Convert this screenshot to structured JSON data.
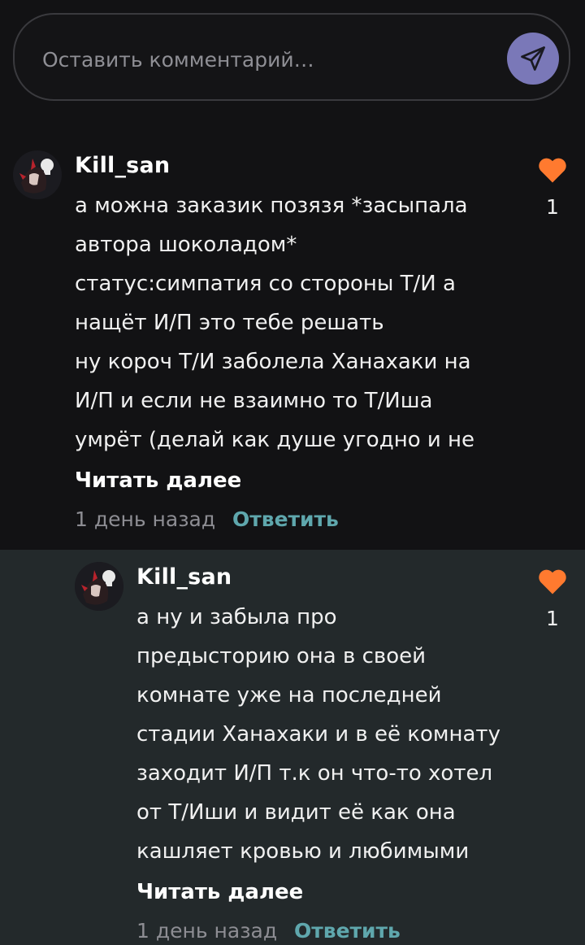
{
  "comment_box": {
    "placeholder": "Оставить комментарий…",
    "send_icon": "send-icon",
    "accent_color": "#7a78b8"
  },
  "comments": [
    {
      "username": "Kill_san",
      "lines": [
        "а можна заказик позязя *засыпала",
        "автора шоколадом*",
        "статус:симпатия со стороны Т/И а",
        "нащёт И/П это тебе решать",
        "ну короч Т/И заболела Ханахаки на",
        "И/П и если не взаимно то Т/Иша",
        "умрёт (делай как душе угодно и не"
      ],
      "read_more": "Читать далее",
      "time": "1 день назад",
      "reply_label": "Ответить",
      "likes": "1",
      "heart_color": "#ff7a2f"
    },
    {
      "username": "Kill_san",
      "lines": [
        "а ну и забыла про",
        "предысторию она в своей",
        "комнате уже на последней",
        "стадии Ханахаки и в её комнату",
        "заходит И/П т.к он что-то хотел",
        "от Т/Иши и видит её как она",
        "кашляет кровью и любимыми"
      ],
      "read_more": "Читать далее",
      "time": "1 день назад",
      "reply_label": "Ответить",
      "likes": "1",
      "heart_color": "#ff7a2f"
    }
  ]
}
